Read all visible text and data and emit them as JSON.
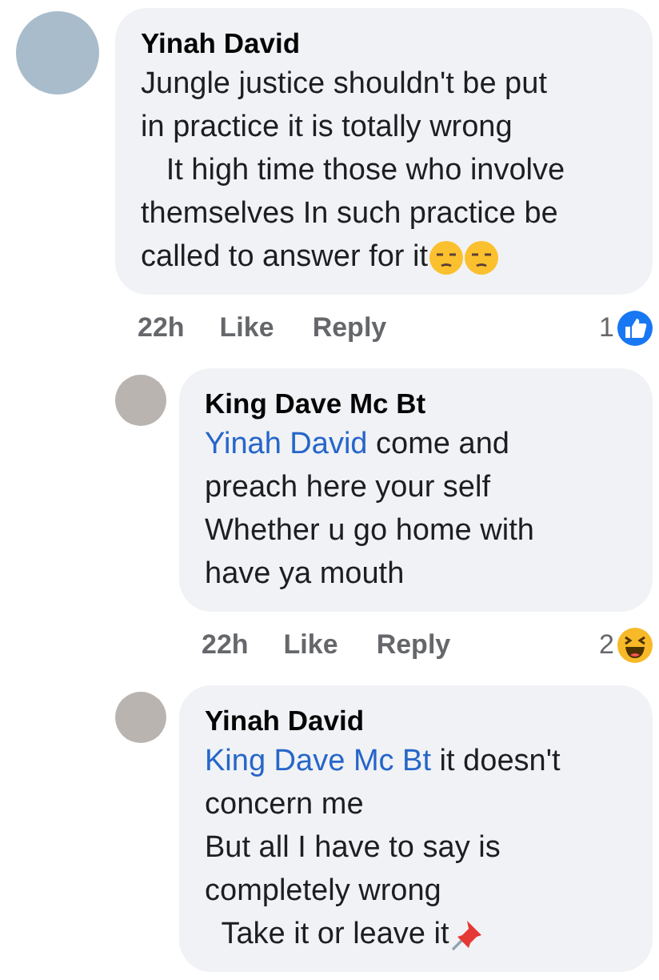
{
  "comments": [
    {
      "kind": "comment",
      "author": "Yinah David",
      "lines": [
        "Jungle justice shouldn't be put",
        "in practice it is totally wrong",
        "   It high time those who involve",
        "themselves In such practice be",
        "called to answer for it"
      ],
      "trailing_icons": [
        {
          "kind": "unamused"
        },
        {
          "kind": "unamused"
        }
      ],
      "meta": {
        "time": "22h",
        "like": "Like",
        "reply": "Reply",
        "count": "1",
        "reaction": {
          "kind": "like"
        }
      }
    },
    {
      "kind": "reply",
      "author": "King Dave Mc Bt",
      "mention": "Yinah David",
      "lines": [
        " come and",
        "preach here your self",
        "Whether u go home with",
        "have ya mouth"
      ],
      "meta": {
        "time": "22h",
        "like": "Like",
        "reply": "Reply",
        "count": "2",
        "reaction": {
          "kind": "haha"
        }
      }
    },
    {
      "kind": "reply",
      "author": "Yinah David",
      "mention": "King Dave Mc Bt",
      "lines": [
        " it doesn't",
        "concern me",
        "But all I have to say is",
        "completely wrong",
        "  Take it or leave it"
      ],
      "trailing_icons": [
        {
          "kind": "pushpin"
        }
      ]
    }
  ]
}
